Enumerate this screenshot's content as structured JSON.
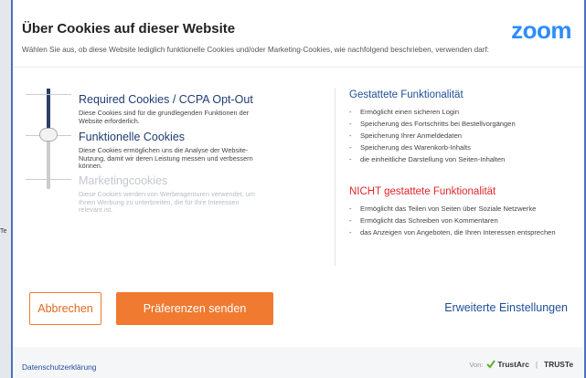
{
  "background": {
    "fragment_text": "Te"
  },
  "header": {
    "title": "Über Cookies auf dieser Website",
    "logo": "zoom",
    "subtitle": "Wählen Sie aus, ob diese Website lediglich funktionelle Cookies und/oder Marketing-Cookies, wie nachfolgend beschrieben, verwenden darf:"
  },
  "levels": [
    {
      "title": "Required Cookies / CCPA Opt-Out",
      "description": "Diese Cookies sind für die grundlegenden Funktionen der Website erforderlich.",
      "active": true
    },
    {
      "title": "Funktionelle Cookies",
      "description": "Diese Cookies ermöglichen uns die Analyse der Website-Nutzung, damit wir deren Leistung messen und verbessern können.",
      "active": true
    },
    {
      "title": "Marketingcookies",
      "description": "Diese Cookies werden von Werbeagenturen verwendet, um Ihnen Werbung zu unterbreiten, die für Ihre Interessen relevant ist.",
      "active": false
    }
  ],
  "slider": {
    "selected_level": 2,
    "level_count": 3
  },
  "allowed": {
    "heading": "Gestattete Funktionalität",
    "items": [
      "Ermöglicht einen sicheren Login",
      "Speicherung des Fortschritts bei Bestellvorgängen",
      "Speicherung Ihrer Anmeldedaten",
      "Speicherung des Warenkorb-Inhalts",
      "die einheitliche Darstellung von Seiten-Inhalten"
    ]
  },
  "denied": {
    "heading": "NICHT gestattete Funktionalität",
    "items": [
      "Ermöglicht das Teilen von Seiten über Soziale Netzwerke",
      "Ermöglicht das Schreiben von Kommentaren",
      "das Anzeigen von Angeboten, die Ihren Interessen entsprechen"
    ]
  },
  "actions": {
    "cancel_label": "Abbrechen",
    "submit_label": "Präferenzen senden",
    "advanced_label": "Erweiterte Einstellungen"
  },
  "footer": {
    "privacy_label": "Datenschutzerklärung",
    "powered_by": "Von:",
    "brand_1": "TrustArc",
    "separator": "|",
    "brand_2": "TRUSTe"
  },
  "colors": {
    "accent": "#f07a30",
    "link": "#1f4e98",
    "danger": "#e0262a",
    "logo": "#2d8cff"
  }
}
